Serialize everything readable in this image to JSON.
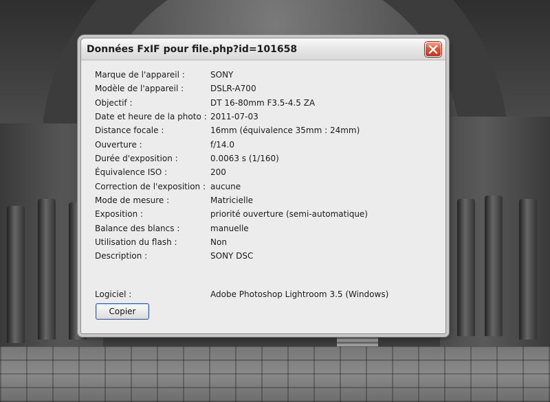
{
  "dialog": {
    "title": "Données FxIF pour file.php?id=101658",
    "close_icon": "close-icon",
    "copy_label": "Copier"
  },
  "fields": [
    {
      "label": "Marque de l'appareil :",
      "value": "SONY"
    },
    {
      "label": "Modèle de l'appareil :",
      "value": "DSLR-A700"
    },
    {
      "label": "Objectif :",
      "value": "DT 16-80mm F3.5-4.5 ZA"
    },
    {
      "label": "Date et heure de la photo :",
      "value": "2011-07-03"
    },
    {
      "label": "Distance focale :",
      "value": "16mm (équivalence 35mm : 24mm)"
    },
    {
      "label": "Ouverture :",
      "value": "f/14.0"
    },
    {
      "label": "Durée d'exposition :",
      "value": "0.0063 s (1/160)"
    },
    {
      "label": "Équivalence ISO :",
      "value": "200"
    },
    {
      "label": "Correction de l'exposition :",
      "value": "aucune"
    },
    {
      "label": "Mode de mesure :",
      "value": "Matricielle"
    },
    {
      "label": "Exposition :",
      "value": "priorité ouverture (semi-automatique)"
    },
    {
      "label": "Balance des blancs :",
      "value": "manuelle"
    },
    {
      "label": "Utilisation du flash :",
      "value": "Non"
    },
    {
      "label": "Description :",
      "value": "SONY DSC"
    }
  ],
  "software": {
    "label": "Logiciel :",
    "value": "Adobe Photoshop Lightroom 3.5 (Windows)"
  },
  "colors": {
    "close_button": "#d9472b",
    "dialog_background": "#ececec",
    "button_border": "#2f5fa8"
  }
}
